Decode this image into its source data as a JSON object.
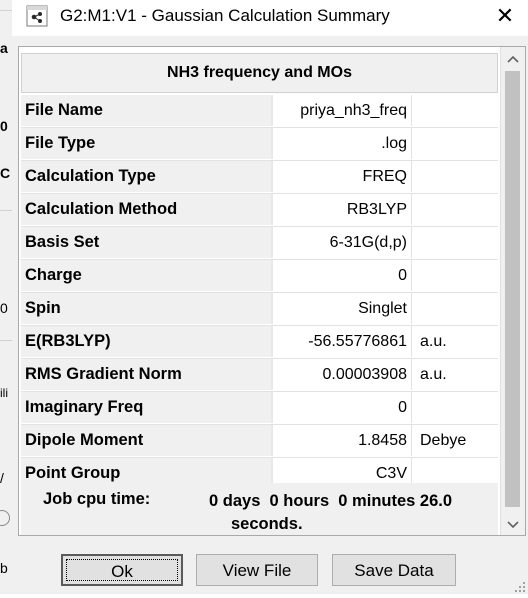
{
  "window": {
    "title": "G2:M1:V1 - Gaussian Calculation Summary",
    "close_glyph": "✕"
  },
  "table": {
    "header": "NH3 frequency and MOs",
    "rows": [
      {
        "label": "File Name",
        "value": "priya_nh3_freq",
        "unit": ""
      },
      {
        "label": "File Type",
        "value": ".log",
        "unit": ""
      },
      {
        "label": "Calculation Type",
        "value": "FREQ",
        "unit": ""
      },
      {
        "label": "Calculation Method",
        "value": "RB3LYP",
        "unit": ""
      },
      {
        "label": "Basis Set",
        "value": "6-31G(d,p)",
        "unit": ""
      },
      {
        "label": "Charge",
        "value": "0",
        "unit": ""
      },
      {
        "label": "Spin",
        "value": "Singlet",
        "unit": ""
      },
      {
        "label": "E(RB3LYP)",
        "value": "-56.55776861",
        "unit": "a.u."
      },
      {
        "label": "RMS Gradient Norm",
        "value": "0.00003908",
        "unit": "a.u."
      },
      {
        "label": "Imaginary Freq",
        "value": "0",
        "unit": ""
      },
      {
        "label": "Dipole Moment",
        "value": "1.8458",
        "unit": "Debye"
      },
      {
        "label": "Point Group",
        "value": "C3V",
        "unit": ""
      }
    ],
    "job_cpu_label": "Job cpu time:",
    "job_cpu_value_line1": "0 days  0 hours  0 minutes 26.0",
    "job_cpu_value_line2": "seconds."
  },
  "scrollbar": {
    "up_glyph": "⌃",
    "down_glyph": "⌄"
  },
  "buttons": {
    "ok": "Ok",
    "view_file": "View File",
    "save_data": "Save Data"
  },
  "behind_window_chars": [
    "a",
    "0",
    "C",
    "0",
    "ili",
    "/",
    "b"
  ]
}
